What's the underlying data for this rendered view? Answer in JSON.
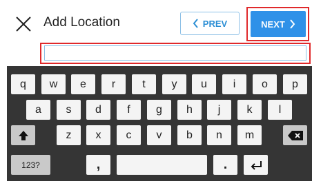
{
  "header": {
    "close_icon": "close-icon",
    "title": "Add Location",
    "prev_label": "PREV",
    "prev_icon": "chevron-left-icon",
    "next_label": "NEXT",
    "next_icon": "chevron-right-icon"
  },
  "location_input": {
    "value": "",
    "placeholder": ""
  },
  "keyboard": {
    "row1": [
      "q",
      "w",
      "e",
      "r",
      "t",
      "y",
      "u",
      "i",
      "o",
      "p"
    ],
    "row2": [
      "a",
      "s",
      "d",
      "f",
      "g",
      "h",
      "j",
      "k",
      "l"
    ],
    "row3": [
      "z",
      "x",
      "c",
      "v",
      "b",
      "n",
      "m"
    ],
    "shift_icon": "shift-arrow-icon",
    "backspace_icon": "backspace-icon",
    "numbers_label": "123?",
    "comma_label": ",",
    "period_label": ".",
    "enter_icon": "enter-icon"
  },
  "colors": {
    "accent": "#2f91e8",
    "highlight_frame": "#e0292b",
    "keyboard_bg": "#353535",
    "key_bg": "#f4f4f4",
    "special_key_bg": "#c9c9c9"
  }
}
